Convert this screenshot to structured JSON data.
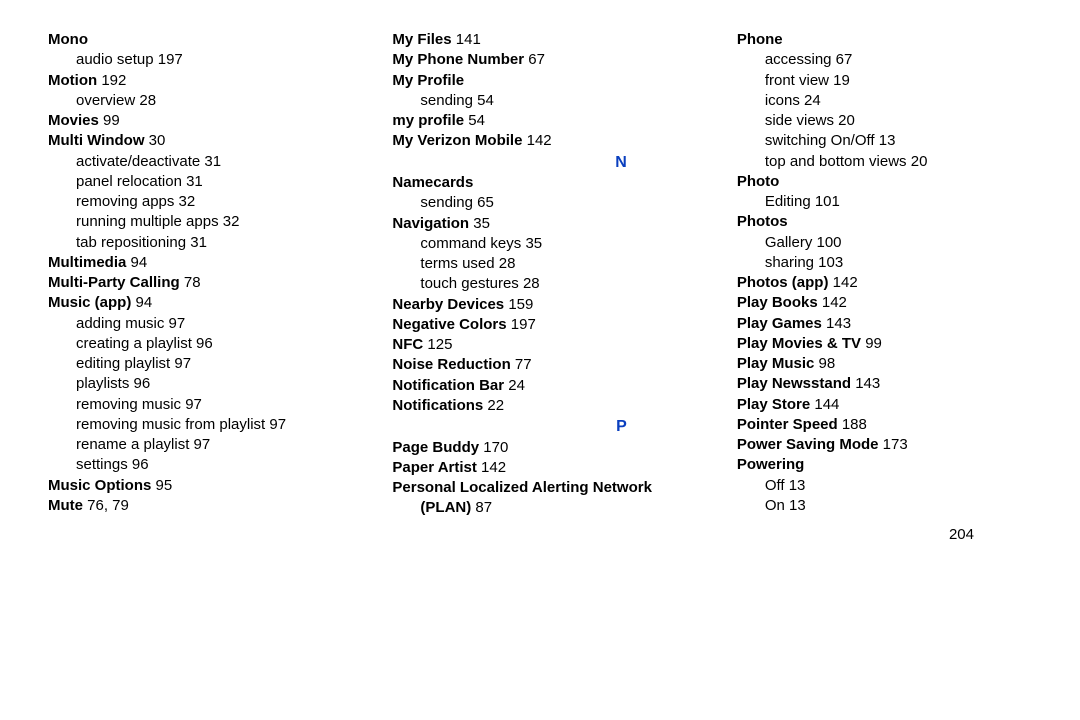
{
  "page_number": "204",
  "letters": {
    "N": "N",
    "P": "P"
  },
  "col1": [
    {
      "t": "Mono",
      "b": true
    },
    {
      "t": "audio setup 197",
      "sub": true
    },
    {
      "t": "Motion",
      "b": true,
      "pg": "192"
    },
    {
      "t": "overview 28",
      "sub": true
    },
    {
      "t": "Movies",
      "b": true,
      "pg": "99"
    },
    {
      "t": "Multi Window",
      "b": true,
      "pg": "30"
    },
    {
      "t": "activate/deactivate 31",
      "sub": true
    },
    {
      "t": "panel relocation 31",
      "sub": true
    },
    {
      "t": "removing apps 32",
      "sub": true
    },
    {
      "t": "running multiple apps 32",
      "sub": true
    },
    {
      "t": "tab repositioning 31",
      "sub": true
    },
    {
      "t": "Multimedia",
      "b": true,
      "pg": "94"
    },
    {
      "t": "Multi-Party Calling",
      "b": true,
      "pg": "78"
    },
    {
      "t": "Music (app)",
      "b": true,
      "pg": "94"
    },
    {
      "t": "adding music 97",
      "sub": true
    },
    {
      "t": "creating a playlist 96",
      "sub": true
    },
    {
      "t": "editing playlist 97",
      "sub": true
    },
    {
      "t": "playlists 96",
      "sub": true
    },
    {
      "t": "removing music 97",
      "sub": true
    },
    {
      "t": "removing music from playlist 97",
      "sub": true
    },
    {
      "t": "rename a playlist 97",
      "sub": true
    },
    {
      "t": "settings 96",
      "sub": true
    },
    {
      "t": "Music Options",
      "b": true,
      "pg": "95"
    },
    {
      "t": "Mute",
      "b": true,
      "pg": "76, 79"
    }
  ],
  "col2": [
    {
      "t": "My Files",
      "b": true,
      "pg": "141"
    },
    {
      "t": "My Phone Number",
      "b": true,
      "pg": "67"
    },
    {
      "t": "My Profile",
      "b": true
    },
    {
      "t": "sending 54",
      "sub": true
    },
    {
      "t": "my profile",
      "b": true,
      "pg": "54"
    },
    {
      "t": "My Verizon Mobile",
      "b": true,
      "pg": "142"
    },
    {
      "letter": "N"
    },
    {
      "t": "Namecards",
      "b": true
    },
    {
      "t": "sending 65",
      "sub": true
    },
    {
      "t": "Navigation",
      "b": true,
      "pg": "35"
    },
    {
      "t": "command keys 35",
      "sub": true
    },
    {
      "t": "terms used 28",
      "sub": true
    },
    {
      "t": "touch gestures 28",
      "sub": true
    },
    {
      "t": "Nearby Devices",
      "b": true,
      "pg": "159"
    },
    {
      "t": "Negative Colors",
      "b": true,
      "pg": "197"
    },
    {
      "t": "NFC",
      "b": true,
      "pg": "125"
    },
    {
      "t": "Noise Reduction",
      "b": true,
      "pg": "77"
    },
    {
      "t": "Notification Bar",
      "b": true,
      "pg": "24"
    },
    {
      "t": "Notifications",
      "b": true,
      "pg": "22"
    },
    {
      "letter": "P"
    },
    {
      "t": "Page Buddy",
      "b": true,
      "pg": "170"
    },
    {
      "t": "Paper Artist",
      "b": true,
      "pg": "142"
    },
    {
      "t": "Personal Localized Alerting Network",
      "b": true
    },
    {
      "t": "(PLAN)",
      "b": true,
      "sub": true,
      "pg": "87"
    }
  ],
  "col3": [
    {
      "t": "Phone",
      "b": true
    },
    {
      "t": "accessing 67",
      "sub": true
    },
    {
      "t": "front view 19",
      "sub": true
    },
    {
      "t": "icons 24",
      "sub": true
    },
    {
      "t": "side views 20",
      "sub": true
    },
    {
      "t": "switching On/Off 13",
      "sub": true
    },
    {
      "t": "top and bottom views 20",
      "sub": true
    },
    {
      "t": "Photo",
      "b": true
    },
    {
      "t": "Editing 101",
      "sub": true
    },
    {
      "t": "Photos",
      "b": true
    },
    {
      "t": "Gallery 100",
      "sub": true
    },
    {
      "t": "sharing 103",
      "sub": true
    },
    {
      "t": "Photos (app)",
      "b": true,
      "pg": "142"
    },
    {
      "t": "Play Books",
      "b": true,
      "pg": "142"
    },
    {
      "t": "Play Games",
      "b": true,
      "pg": "143"
    },
    {
      "t": "Play Movies & TV",
      "b": true,
      "pg": "99"
    },
    {
      "t": "Play Music",
      "b": true,
      "pg": "98"
    },
    {
      "t": "Play Newsstand",
      "b": true,
      "pg": "143"
    },
    {
      "t": "Play Store",
      "b": true,
      "pg": "144"
    },
    {
      "t": "Pointer Speed",
      "b": true,
      "pg": "188"
    },
    {
      "t": "Power Saving Mode",
      "b": true,
      "pg": "173"
    },
    {
      "t": "Powering",
      "b": true
    },
    {
      "t": "Off 13",
      "sub": true
    },
    {
      "t": "On 13",
      "sub": true
    }
  ]
}
